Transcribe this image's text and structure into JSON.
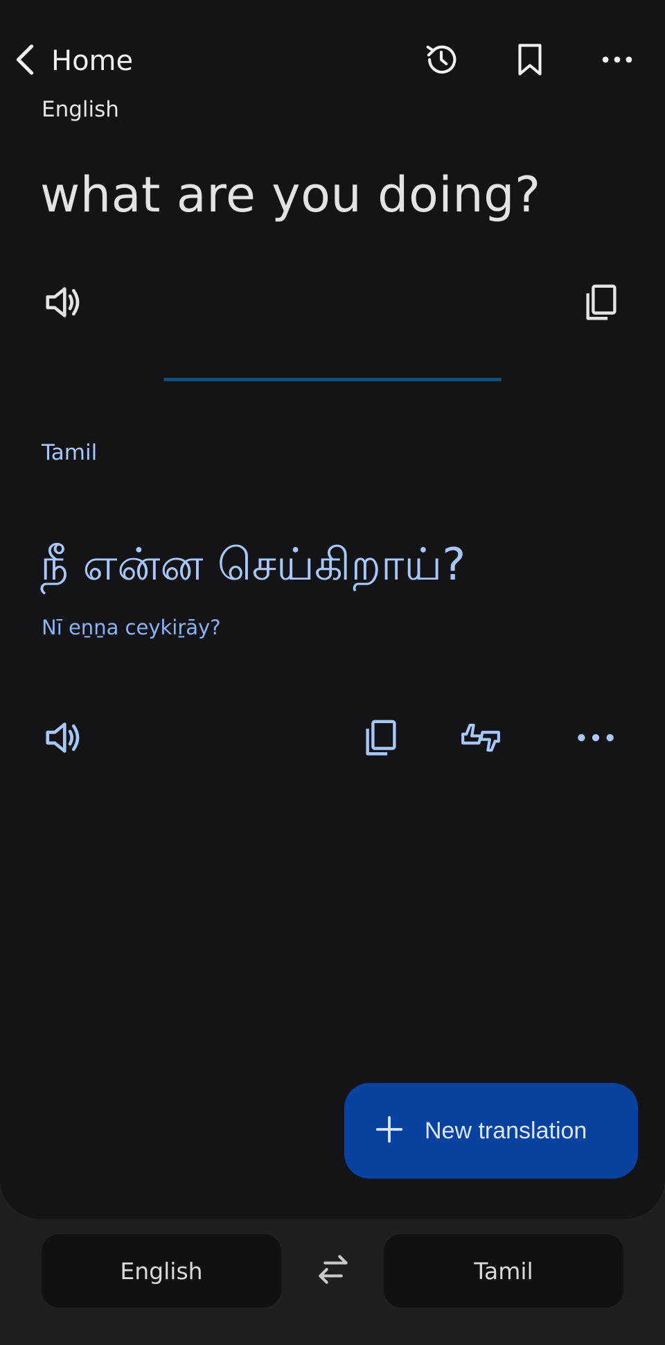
{
  "topbar": {
    "back_label": "Home"
  },
  "icons": {
    "back": "chevron-left-icon",
    "history": "history-icon",
    "saved": "bookmark-icon",
    "more": "more-horizontal-icon"
  },
  "source": {
    "language": "English",
    "text": "what are you doing?"
  },
  "target": {
    "language": "Tamil",
    "text": "நீ என்ன செய்கிறாய்?",
    "transliteration": "Nī eṉṉa ceykiṟāy?"
  },
  "fab": {
    "label": "New translation"
  },
  "language_bar": {
    "source_language": "English",
    "target_language": "Tamil"
  },
  "colors": {
    "background": "#141416",
    "accent": "#a8c7fa",
    "fab": "#0842a0",
    "divider": "#0e4f78"
  }
}
